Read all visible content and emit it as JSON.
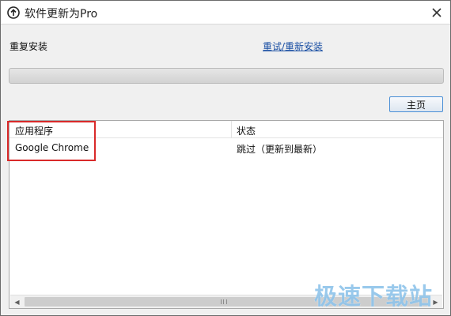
{
  "window": {
    "title": "软件更新为Pro",
    "icons": {
      "app": "update-arrow-icon",
      "close": "close-icon"
    }
  },
  "status": {
    "label": "重复安装",
    "retry_link": "重试/重新安装"
  },
  "progress": {
    "value": 0
  },
  "toolbar": {
    "home_label": "主页"
  },
  "list": {
    "columns": [
      "应用程序",
      "状态"
    ],
    "rows": [
      {
        "app": "Google Chrome",
        "status": "跳过（更新到最新）"
      }
    ]
  },
  "scrollbar": {
    "grip_icon": "scroll-grip-icon"
  },
  "watermark": {
    "text": "极速下载站"
  },
  "colors": {
    "accent_link": "#1a4fa3",
    "highlight": "#d92a2a",
    "watermark": "#8fc4ea"
  }
}
